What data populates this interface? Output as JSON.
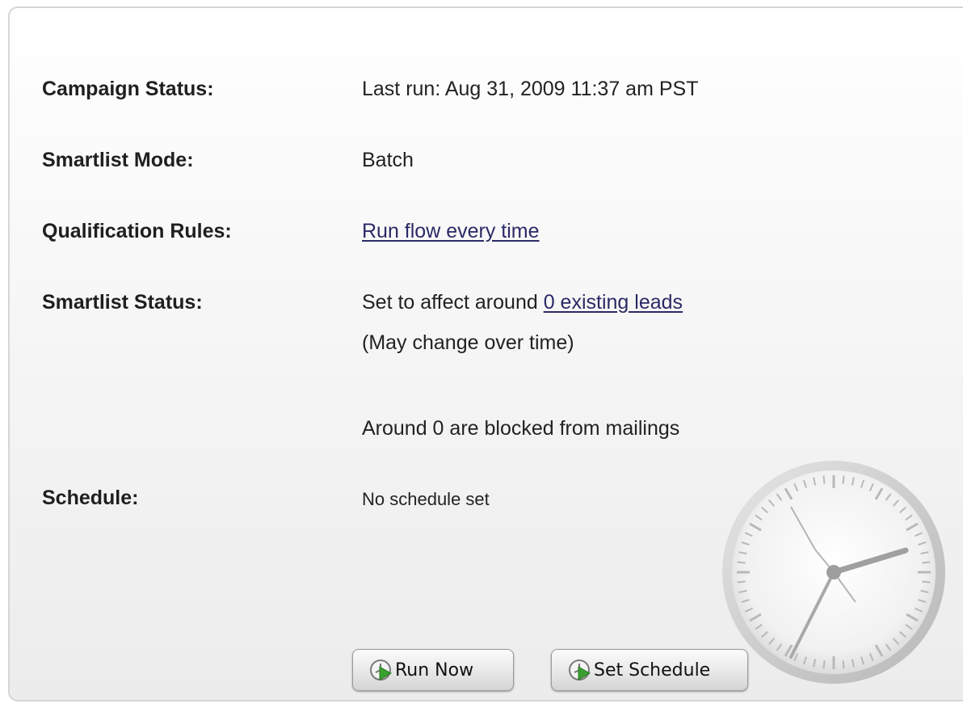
{
  "fields": {
    "campaign_status": {
      "label": "Campaign Status:",
      "value": "Last run: Aug 31, 2009 11:37 am PST"
    },
    "smartlist_mode": {
      "label": "Smartlist Mode:",
      "value": "Batch"
    },
    "qualification_rules": {
      "label": "Qualification Rules:",
      "link": "Run flow every time"
    },
    "smartlist_status": {
      "label": "Smartlist Status:",
      "prefix": "Set to affect around ",
      "link": "0 existing leads",
      "note": "(May change over time)",
      "blocked": "Around 0 are blocked from mailings"
    },
    "schedule": {
      "label": "Schedule:",
      "value": "No schedule set"
    }
  },
  "buttons": {
    "run_now": "Run Now",
    "set_schedule": "Set Schedule"
  },
  "icons": {
    "button_icon": "clock-play-icon",
    "decoration": "wall-clock-icon"
  },
  "colors": {
    "link": "#2a2a66",
    "play_green": "#3aa030"
  }
}
